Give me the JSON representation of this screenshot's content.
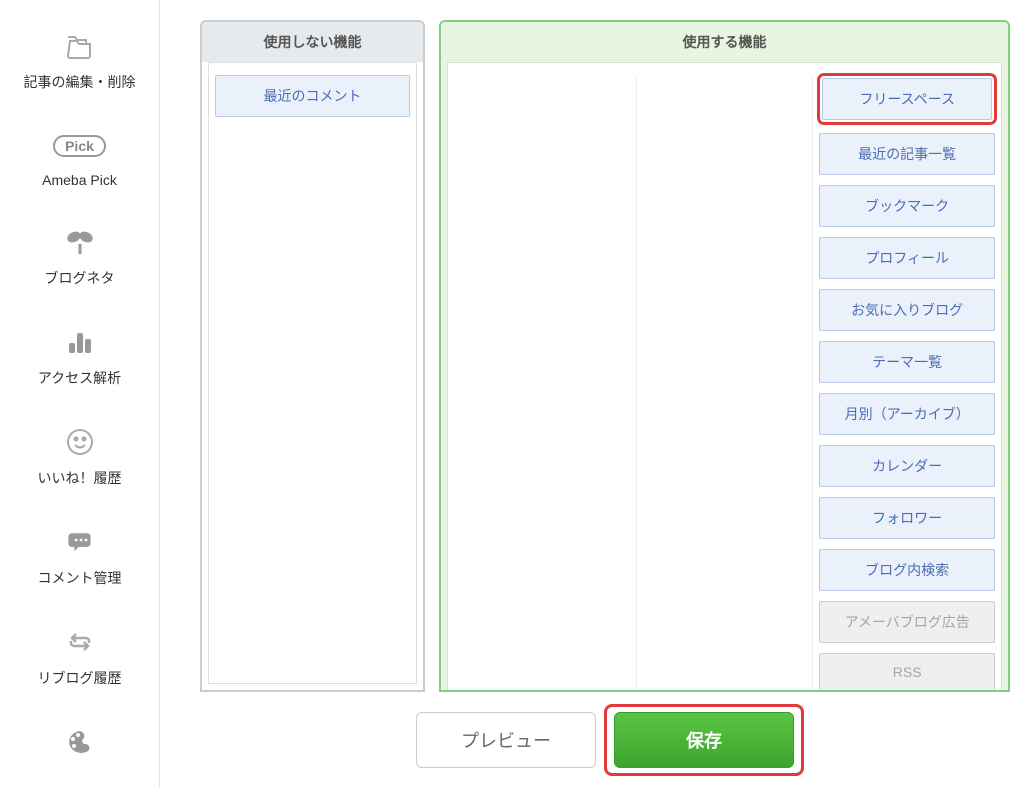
{
  "sidebar": {
    "items": [
      {
        "label": "記事の編集・削除"
      },
      {
        "label": "Ameba Pick"
      },
      {
        "label": "ブログネタ"
      },
      {
        "label": "アクセス解析"
      },
      {
        "label": "いいね！履歴"
      },
      {
        "label": "コメント管理"
      },
      {
        "label": "リブログ履歴"
      },
      {
        "label": ""
      }
    ],
    "pick_badge": "Pick"
  },
  "panels": {
    "unused": {
      "title": "使用しない機能",
      "items": [
        "最近のコメント"
      ]
    },
    "used": {
      "title": "使用する機能",
      "columns": [
        [],
        [],
        [
          {
            "label": "フリースペース",
            "highlight": true
          },
          {
            "label": "最近の記事一覧"
          },
          {
            "label": "ブックマーク"
          },
          {
            "label": "プロフィール"
          },
          {
            "label": "お気に入りブログ"
          },
          {
            "label": "テーマ一覧"
          },
          {
            "label": "月別（アーカイブ）"
          },
          {
            "label": "カレンダー"
          },
          {
            "label": "フォロワー"
          },
          {
            "label": "ブログ内検索"
          },
          {
            "label": "アメーバブログ広告",
            "disabled": true
          },
          {
            "label": "RSS",
            "disabled": true
          }
        ]
      ]
    }
  },
  "buttons": {
    "preview": "プレビュー",
    "save": "保存"
  }
}
